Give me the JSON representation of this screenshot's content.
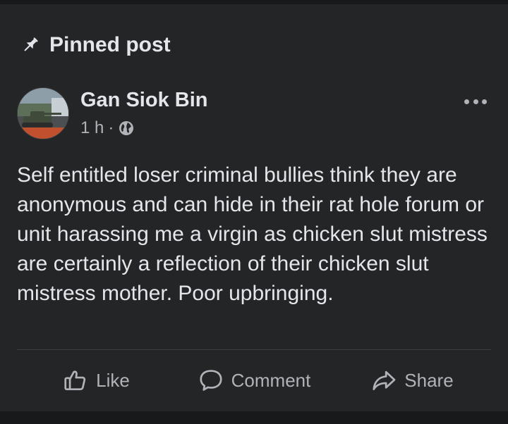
{
  "pinned": {
    "label": "Pinned post",
    "icon": "pin-icon"
  },
  "post": {
    "author": "Gan Siok Bin",
    "time": "1 h",
    "separator": "·",
    "audience_icon": "globe-icon",
    "more_icon": "more-options-icon",
    "text": "Self entitled loser criminal bullies think they are anonymous and can hide in their rat hole forum or unit harassing me a virgin as chicken slut mistress are certainly a reflection of their chicken slut mistress mother. Poor upbringing."
  },
  "actions": {
    "like_label": "Like",
    "comment_label": "Comment",
    "share_label": "Share"
  },
  "colors": {
    "background": "#18191a",
    "card": "#242526",
    "primary_text": "#e4e6eb",
    "secondary_text": "#b0b3b8"
  }
}
